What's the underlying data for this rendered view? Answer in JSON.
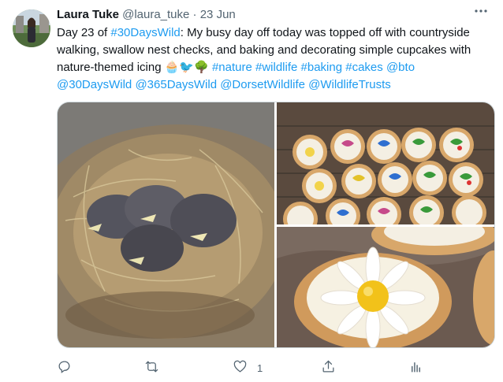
{
  "tweet": {
    "author_name": "Laura Tuke",
    "handle": "@laura_tuke",
    "separator": "·",
    "date": "23 Jun",
    "text_parts": [
      {
        "text": "Day 23 of ",
        "tag": false
      },
      {
        "text": "#30DaysWild",
        "tag": true
      },
      {
        "text": ": My busy day off today was topped off with countryside walking, swallow nest checks, and baking and decorating simple cupcakes with nature-themed icing 🧁🐦🌳 ",
        "tag": false
      },
      {
        "text": "#nature",
        "tag": true
      },
      {
        "text": " ",
        "tag": false
      },
      {
        "text": "#wildlife",
        "tag": true
      },
      {
        "text": " ",
        "tag": false
      },
      {
        "text": "#baking",
        "tag": true
      },
      {
        "text": " ",
        "tag": false
      },
      {
        "text": "#cakes",
        "tag": true
      },
      {
        "text": " ",
        "tag": false
      },
      {
        "text": "@bto",
        "tag": true
      },
      {
        "text": " ",
        "tag": false
      },
      {
        "text": "@30DaysWild",
        "tag": true
      },
      {
        "text": " ",
        "tag": false
      },
      {
        "text": "@365DaysWild",
        "tag": true
      },
      {
        "text": " ",
        "tag": false
      },
      {
        "text": "@DorsetWildlife",
        "tag": true
      },
      {
        "text": " ",
        "tag": false
      },
      {
        "text": "@WildlifeTrusts",
        "tag": true
      }
    ]
  },
  "actions": {
    "reply_count": "",
    "retweet_count": "",
    "like_count": "1"
  },
  "colors": {
    "link": "#1d9bf0",
    "secondary_text": "#536471",
    "border": "#cfd9de"
  },
  "icons": [
    "more-icon",
    "reply-icon",
    "retweet-icon",
    "like-icon",
    "share-icon",
    "analytics-icon"
  ]
}
